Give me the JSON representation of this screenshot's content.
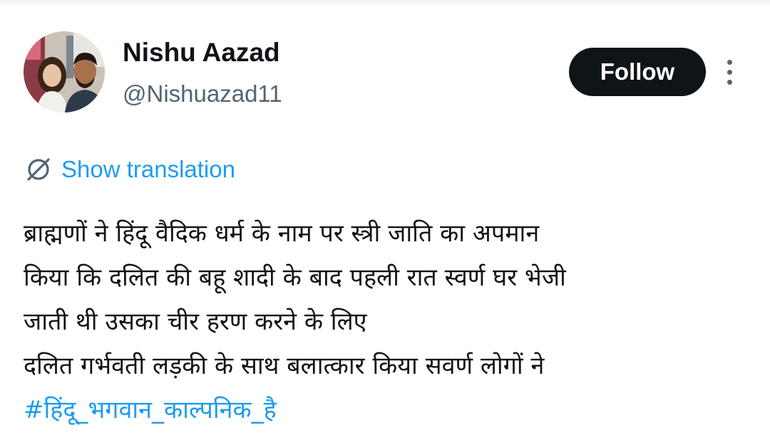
{
  "author": {
    "display_name": "Nishu Aazad",
    "handle": "@Nishuazad11",
    "avatar_icon": "profile-photo"
  },
  "actions": {
    "follow_label": "Follow",
    "more_icon": "more-vertical-icon"
  },
  "translation": {
    "icon": "translate-icon",
    "label": "Show translation"
  },
  "tweet": {
    "lines": [
      "ब्राह्मणों ने हिंदू वैदिक धर्म के नाम पर स्त्री जाति का अपमान",
      "किया कि दलित की बहू शादी के बाद पहली रात स्वर्ण घर भेजी",
      "जाती थी उसका चीर हरण करने के लिए",
      "दलित गर्भवती लड़की के साथ बलात्कार किया सवर्ण लोगों ने"
    ],
    "hashtag": "#हिंदू_भगवान_काल्पनिक_है"
  },
  "colors": {
    "text": "#0f1419",
    "secondary": "#536471",
    "link": "#1d9bf0",
    "button_bg": "#0f1419",
    "button_text": "#ffffff"
  }
}
